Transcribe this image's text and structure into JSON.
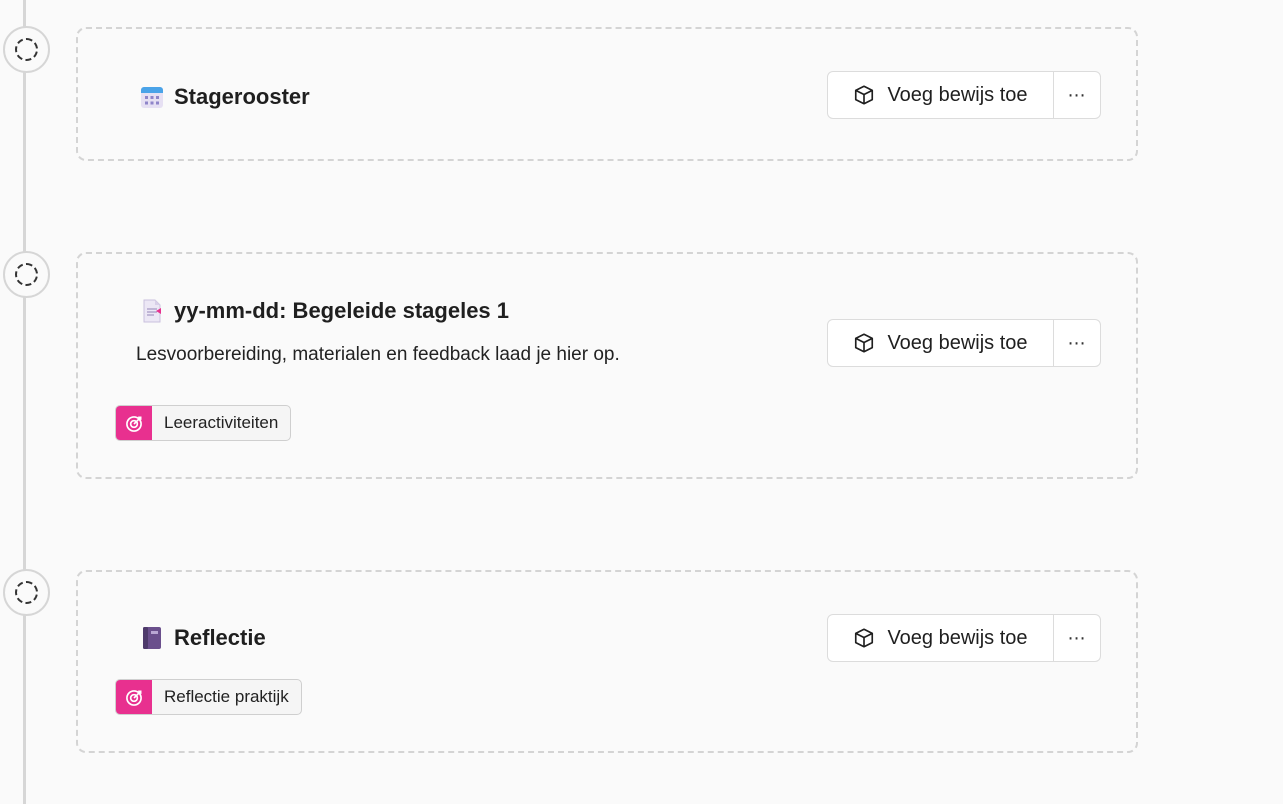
{
  "items": [
    {
      "title": "Stagerooster",
      "emoji_icon": "calendar-icon",
      "add_evidence_label": "Voeg bewijs toe",
      "more_label": "⋯"
    },
    {
      "title": "yy-mm-dd: Begeleide stageles 1",
      "emoji_icon": "document-icon",
      "description": "Lesvoorbereiding, materialen en feedback laad je hier op.",
      "add_evidence_label": "Voeg bewijs toe",
      "more_label": "⋯",
      "tag": {
        "label": "Leeractiviteiten",
        "icon": "target-icon",
        "color": "#e8308f"
      }
    },
    {
      "title": "Reflectie",
      "emoji_icon": "notebook-icon",
      "add_evidence_label": "Voeg bewijs toe",
      "more_label": "⋯",
      "tag": {
        "label": "Reflectie praktijk",
        "icon": "target-icon",
        "color": "#e8308f"
      }
    }
  ]
}
